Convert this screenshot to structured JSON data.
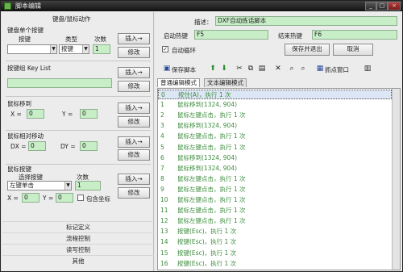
{
  "window": {
    "title": "脚本编辑",
    "min": "_",
    "max": "□",
    "close": "×"
  },
  "left": {
    "header": "键盘/鼠标动作",
    "kb_single": {
      "title": "键盘单个按键",
      "key_label": "按键",
      "type_label": "类型",
      "count_label": "次数",
      "key_value": "",
      "type_value": "按键",
      "count_value": "1",
      "insert": "插入→",
      "modify": "修改"
    },
    "kb_group": {
      "title": "按键组 Key List",
      "value": "",
      "insert": "插入→",
      "modify": "修改"
    },
    "mouse_move": {
      "title": "鼠标移到",
      "x_label": "X =",
      "x_value": "0",
      "y_label": "Y =",
      "y_value": "0",
      "insert": "插入→",
      "modify": "修改"
    },
    "mouse_rel": {
      "title": "鼠标相对移动",
      "dx_label": "DX =",
      "dx_value": "0",
      "dy_label": "DY =",
      "dy_value": "0",
      "insert": "插入→",
      "modify": "修改"
    },
    "mouse_btn": {
      "title": "鼠标按键",
      "select_label": "选择按键",
      "count_label": "次数",
      "select_value": "左键单击",
      "count_value": "1",
      "x_label": "X =",
      "x_value": "0",
      "y_label": "Y =",
      "y_value": "0",
      "coord_label": "包含坐标",
      "insert": "插入→",
      "modify": "修改"
    },
    "nav": [
      "标记定义",
      "流程控制",
      "读写控制",
      "其他"
    ]
  },
  "right": {
    "desc_label": "描述：",
    "desc_value": "DXF自动炼话脚本",
    "start_hotkey_label": "启动热键",
    "start_hotkey_value": "F5",
    "end_hotkey_label": "结束热键",
    "end_hotkey_value": "F6",
    "auto_loop_label": "自动循环",
    "auto_loop_checked": "✓",
    "save_exit": "保存并退出",
    "cancel": "取消",
    "toolbar": {
      "save_label": "保存脚本",
      "capture_label": "抓点窗口"
    },
    "tabs": [
      "普通编辑模式",
      "文本编辑模式"
    ],
    "lines": [
      {
        "n": "0",
        "t": "按住(A)，执行 1 次"
      },
      {
        "n": "1",
        "t": "鼠标移到(1324, 904)"
      },
      {
        "n": "2",
        "t": "鼠标左键点击，执行 1 次"
      },
      {
        "n": "3",
        "t": "鼠标移到(1324, 904)"
      },
      {
        "n": "4",
        "t": "鼠标左键点击，执行 1 次"
      },
      {
        "n": "5",
        "t": "鼠标左键点击，执行 1 次"
      },
      {
        "n": "6",
        "t": "鼠标移到(1324, 904)"
      },
      {
        "n": "7",
        "t": "鼠标移到(1324, 904)"
      },
      {
        "n": "8",
        "t": "鼠标左键点击，执行 1 次"
      },
      {
        "n": "9",
        "t": "鼠标左键点击，执行 1 次"
      },
      {
        "n": "10",
        "t": "鼠标左键点击，执行 1 次"
      },
      {
        "n": "11",
        "t": "鼠标左键点击，执行 1 次"
      },
      {
        "n": "12",
        "t": "鼠标左键点击，执行 1 次"
      },
      {
        "n": "13",
        "t": "按键(Esc)，执行 1 次"
      },
      {
        "n": "14",
        "t": "按键(Esc)，执行 1 次"
      },
      {
        "n": "15",
        "t": "按键(Esc)，执行 1 次"
      },
      {
        "n": "16",
        "t": "按键(Esc)，执行 1 次"
      }
    ]
  },
  "colors": {
    "line_text": "#3c8c3c",
    "field_bg": "#c8eec8",
    "titlebar": "#1a1a1a"
  }
}
